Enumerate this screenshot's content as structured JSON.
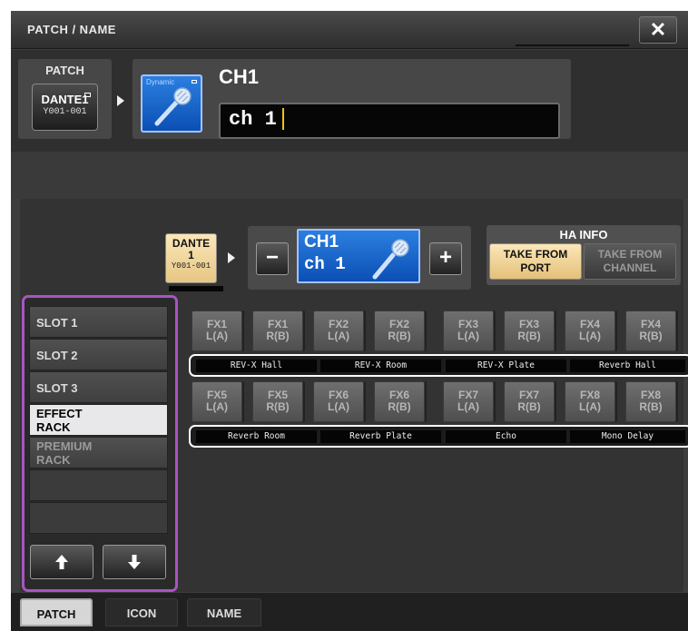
{
  "window": {
    "title": "PATCH / NAME",
    "close_label": "✕"
  },
  "patch": {
    "label": "PATCH",
    "port_name": "DANTE1",
    "port_address": "Y001-001"
  },
  "channel": {
    "icon_caption": "Dynamic",
    "title": "CH1",
    "name_value": "ch 1"
  },
  "selector": {
    "port_line1": "DANTE",
    "port_line2": "1",
    "port_line3": "Y001-001",
    "minus_label": "−",
    "plus_label": "+",
    "ch_title": "CH1",
    "ch_name": "ch 1"
  },
  "ha_info": {
    "title": "HA INFO",
    "take_from_port": "TAKE FROM\nPORT",
    "take_from_channel": "TAKE FROM\nCHANNEL"
  },
  "slots": [
    {
      "label": "SLOT 1",
      "state": "normal"
    },
    {
      "label": "SLOT 2",
      "state": "normal"
    },
    {
      "label": "SLOT 3",
      "state": "normal"
    },
    {
      "label": "EFFECT\nRACK",
      "state": "selected"
    },
    {
      "label": "PREMIUM\nRACK",
      "state": "dim"
    },
    {
      "label": "",
      "state": "empty"
    },
    {
      "label": "",
      "state": "empty"
    }
  ],
  "slot_nav": {
    "up_label": "🡅",
    "down_label": "🡇"
  },
  "fx_row1": [
    "FX1\nL(A)",
    "FX1\nR(B)",
    "FX2\nL(A)",
    "FX2\nR(B)",
    "FX3\nL(A)",
    "FX3\nR(B)",
    "FX4\nL(A)",
    "FX4\nR(B)"
  ],
  "fx_names1": [
    "REV-X Hall",
    "REV-X Room",
    "REV-X Plate",
    "Reverb Hall"
  ],
  "fx_row2": [
    "FX5\nL(A)",
    "FX5\nR(B)",
    "FX6\nL(A)",
    "FX6\nR(B)",
    "FX7\nL(A)",
    "FX7\nR(B)",
    "FX8\nL(A)",
    "FX8\nR(B)"
  ],
  "fx_names2": [
    "Reverb Room",
    "Reverb Plate",
    "Echo",
    "Mono Delay"
  ],
  "tabs": [
    {
      "label": "PATCH",
      "active": true
    },
    {
      "label": "ICON",
      "active": false
    },
    {
      "label": "NAME",
      "active": false
    }
  ]
}
